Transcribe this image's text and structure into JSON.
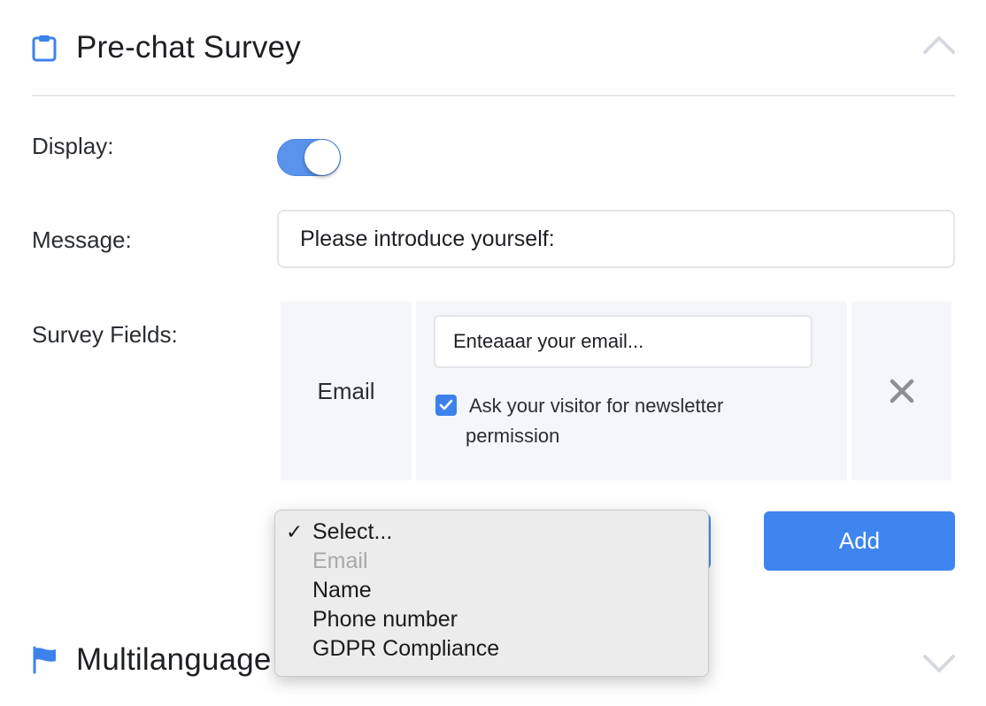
{
  "prechat": {
    "title": "Pre-chat Survey",
    "display_label": "Display:",
    "display_on": true,
    "message_label": "Message:",
    "message_value": "Please introduce yourself:",
    "survey_fields_label": "Survey Fields:"
  },
  "fields": [
    {
      "name": "Email",
      "placeholder_value": "Enteaaar your email...",
      "newsletter_checked": true,
      "newsletter_label_line1": "Ask your visitor for newsletter",
      "newsletter_label_line2": "permission"
    }
  ],
  "field_select": {
    "selected": "Select...",
    "options": [
      {
        "label": "Select...",
        "selected": true,
        "disabled": false
      },
      {
        "label": "Email",
        "selected": false,
        "disabled": true
      },
      {
        "label": "Name",
        "selected": false,
        "disabled": false
      },
      {
        "label": "Phone number",
        "selected": false,
        "disabled": false
      },
      {
        "label": "GDPR Compliance",
        "selected": false,
        "disabled": false
      }
    ]
  },
  "add_button_label": "Add",
  "multilanguage": {
    "title": "Multilanguage"
  },
  "colors": {
    "accent": "#3e85ef",
    "toggle_on": "#5a93ec",
    "cell_bg": "#f4f6f9",
    "divider": "#e7e9ee"
  },
  "icons": {
    "section": "clipboard-icon",
    "collapse": "chevron-up-icon",
    "remove": "close-icon",
    "multilanguage": "flag-icon",
    "expand": "chevron-down-icon"
  }
}
